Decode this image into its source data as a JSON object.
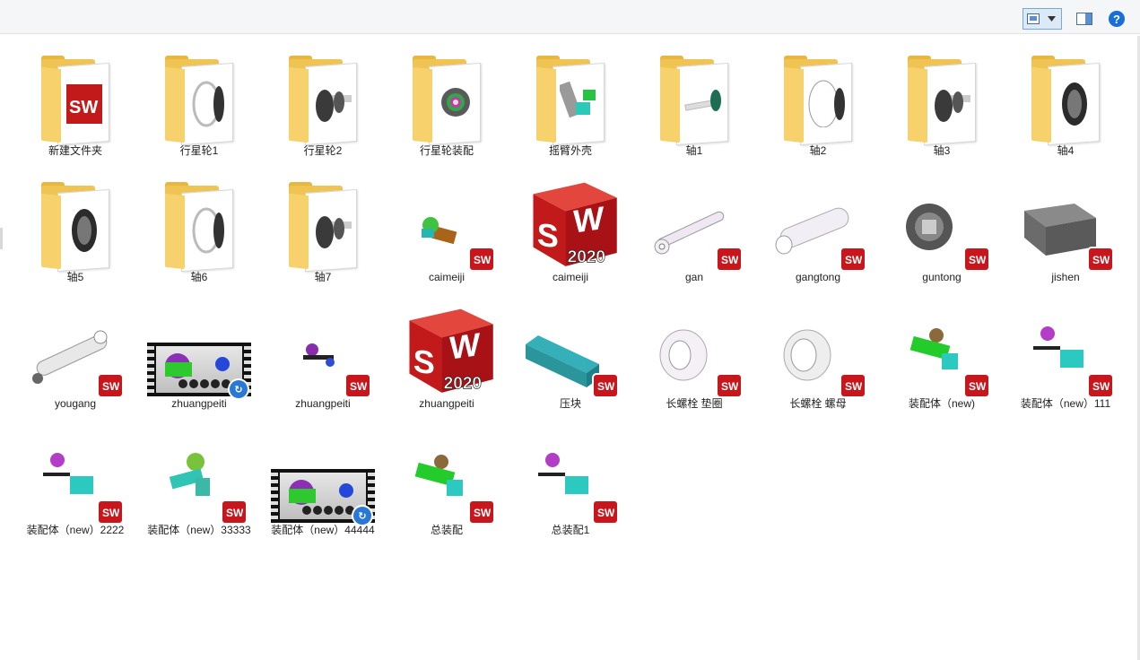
{
  "toolbar": {
    "view_icon": "view-thumbnails-icon",
    "dropdown_icon": "chevron-down-icon",
    "preview_pane_icon": "preview-pane-icon",
    "help_label": "?"
  },
  "colors": {
    "folder": "#f0c453",
    "sw_red": "#c8161d",
    "accent": "#1a6fd6"
  },
  "items": [
    {
      "label": "新建文件夹",
      "type": "folder",
      "preview": "sw"
    },
    {
      "label": "行星轮1",
      "type": "folder",
      "preview": "ring"
    },
    {
      "label": "行星轮2",
      "type": "folder",
      "preview": "gearshaft"
    },
    {
      "label": "行星轮装配",
      "type": "folder",
      "preview": "planet"
    },
    {
      "label": "摇臂外壳",
      "type": "folder",
      "preview": "arm"
    },
    {
      "label": "轴1",
      "type": "folder",
      "preview": "shaft"
    },
    {
      "label": "轴2",
      "type": "folder",
      "preview": "ringgear"
    },
    {
      "label": "轴3",
      "type": "folder",
      "preview": "gearshaft"
    },
    {
      "label": "轴4",
      "type": "folder",
      "preview": "gear"
    },
    {
      "label": "轴5",
      "type": "folder",
      "preview": "gear"
    },
    {
      "label": "轴6",
      "type": "folder",
      "preview": "ring"
    },
    {
      "label": "轴7",
      "type": "folder",
      "preview": "gearshaft"
    },
    {
      "label": "caimeiji",
      "type": "part",
      "preview": "assembly_small"
    },
    {
      "label": "caimeiji",
      "type": "bigsw"
    },
    {
      "label": "gan",
      "type": "part",
      "preview": "rod"
    },
    {
      "label": "gangtong",
      "type": "part",
      "preview": "cylinder"
    },
    {
      "label": "guntong",
      "type": "part",
      "preview": "drum"
    },
    {
      "label": "jishen",
      "type": "part",
      "preview": "body"
    },
    {
      "label": "yougang",
      "type": "part",
      "preview": "rod2"
    },
    {
      "label": "zhuangpeiti",
      "type": "video"
    },
    {
      "label": "zhuangpeiti",
      "type": "part",
      "preview": "assembly_tiny"
    },
    {
      "label": "zhuangpeiti",
      "type": "bigsw"
    },
    {
      "label": "压块",
      "type": "part",
      "preview": "block"
    },
    {
      "label": "长螺栓 垫圈",
      "type": "part",
      "preview": "washer"
    },
    {
      "label": "长螺栓 螺母",
      "type": "part",
      "preview": "nut"
    },
    {
      "label": "装配体（new)",
      "type": "part",
      "preview": "green_asm"
    },
    {
      "label": "装配体（new）111",
      "type": "part",
      "preview": "cyan_asm"
    },
    {
      "label": "装配体（new）2222",
      "type": "part",
      "preview": "cyan_asm"
    },
    {
      "label": "装配体（new）33333",
      "type": "part",
      "preview": "teal_asm"
    },
    {
      "label": "装配体（new）44444",
      "type": "video"
    },
    {
      "label": "总装配",
      "type": "part",
      "preview": "green_asm"
    },
    {
      "label": "总装配1",
      "type": "part",
      "preview": "cyan_asm"
    }
  ],
  "sw_text": "SW",
  "sw_year": "2020"
}
